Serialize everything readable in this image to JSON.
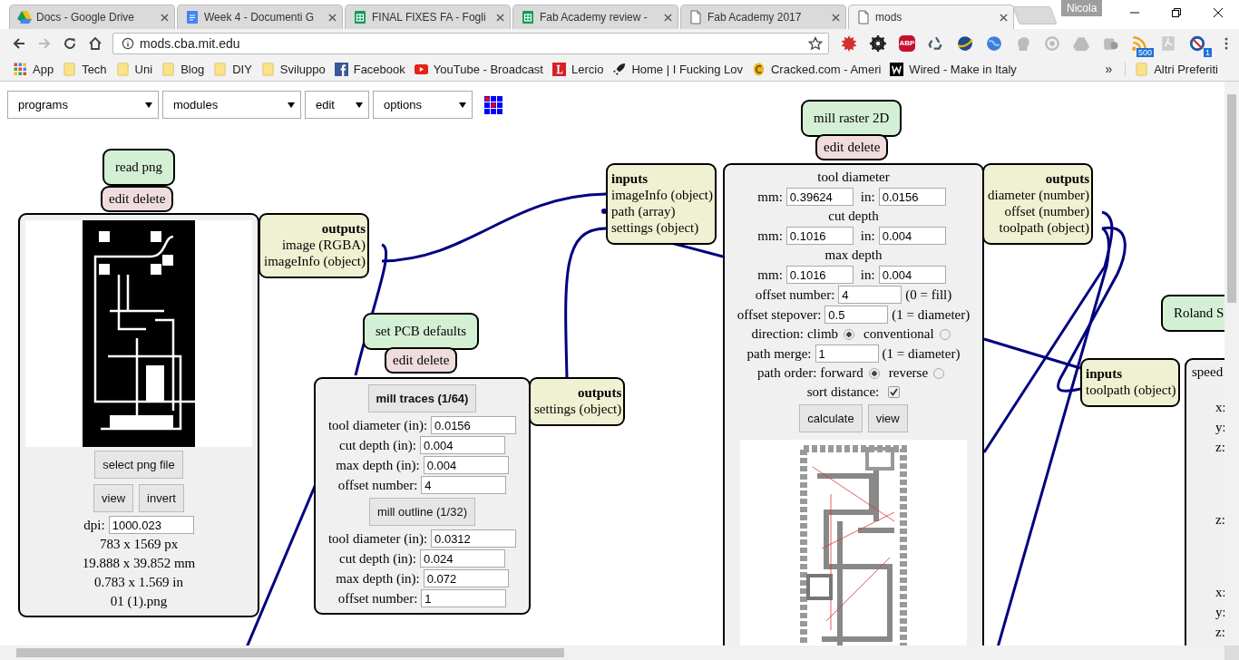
{
  "tabs": [
    {
      "title": "Docs - Google Drive",
      "kind": "drive",
      "selected": false
    },
    {
      "title": "Week 4 - Documenti G",
      "kind": "docs",
      "selected": false
    },
    {
      "title": "FINAL FIXES FA - Fogli",
      "kind": "sheets",
      "selected": false
    },
    {
      "title": "Fab Academy review -",
      "kind": "sheets",
      "selected": false
    },
    {
      "title": "Fab Academy 2017",
      "kind": "page",
      "selected": false
    },
    {
      "title": "mods",
      "kind": "page",
      "selected": true
    }
  ],
  "profile": "Nicola",
  "address": "mods.cba.mit.edu",
  "extensions": [
    {
      "kind": "burst"
    },
    {
      "kind": "gear"
    },
    {
      "kind": "octagon",
      "label": "ABP"
    },
    {
      "kind": "recycle"
    },
    {
      "kind": "planet"
    },
    {
      "kind": "globe"
    },
    {
      "kind": "head"
    },
    {
      "kind": "ring"
    },
    {
      "kind": "drive"
    },
    {
      "kind": "puzzle"
    },
    {
      "kind": "rss",
      "badge": "500"
    },
    {
      "kind": "pdf"
    },
    {
      "kind": "nosign",
      "badge": "1"
    }
  ],
  "bookmarks": [
    {
      "label": "App",
      "kind": "apps"
    },
    {
      "label": "Tech",
      "kind": "folder"
    },
    {
      "label": "Uni",
      "kind": "folder"
    },
    {
      "label": "Blog",
      "kind": "folder"
    },
    {
      "label": "DIY",
      "kind": "folder"
    },
    {
      "label": "Sviluppo",
      "kind": "folder"
    },
    {
      "label": "Facebook",
      "kind": "facebook"
    },
    {
      "label": "YouTube - Broadcast",
      "kind": "youtube"
    },
    {
      "label": "Lercio",
      "kind": "lercio"
    },
    {
      "label": "Home | I Fucking Lov",
      "kind": "rocket"
    },
    {
      "label": "Cracked.com - Ameri",
      "kind": "coin"
    },
    {
      "label": "Wired - Make in Italy",
      "kind": "wired"
    }
  ],
  "bookmarks_more": "»",
  "other_bookmarks": "Altri Preferiti",
  "menus": [
    "programs",
    "modules",
    "edit",
    "options"
  ],
  "modules": [
    {
      "title": "read png",
      "actions": [
        "edit",
        "delete"
      ],
      "outputs": {
        "heading": "outputs",
        "ports": [
          "image (RGBA)",
          "imageInfo (object)"
        ]
      },
      "body": [
        {
          "kind": "picture"
        },
        {
          "kind": "buttons",
          "buttons": [
            {
              "label": "select png file"
            }
          ]
        },
        {
          "kind": "buttons",
          "buttons": [
            {
              "label": "view"
            },
            {
              "label": "invert"
            }
          ]
        },
        {
          "kind": "field",
          "label": "dpi:",
          "value": "1000.023"
        },
        {
          "kind": "text",
          "text": "783 x 1569 px"
        },
        {
          "kind": "text",
          "text": "19.888 x 39.852 mm"
        },
        {
          "kind": "text",
          "text": "0.783 x 1.569 in"
        },
        {
          "kind": "text",
          "text": "01 (1).png"
        }
      ]
    },
    {
      "title": "set PCB defaults",
      "actions": [
        "edit",
        "delete"
      ],
      "outputs": {
        "heading": "outputs",
        "ports": [
          "settings (object)"
        ]
      },
      "body": [
        {
          "kind": "buttons",
          "buttons": [
            {
              "label": "mill traces (1/64)",
              "selected": true
            }
          ]
        },
        {
          "kind": "field",
          "label": "tool diameter (in):",
          "value": "0.0156"
        },
        {
          "kind": "field",
          "label": "cut depth (in):",
          "value": "0.004"
        },
        {
          "kind": "field",
          "label": "max depth (in):",
          "value": "0.004"
        },
        {
          "kind": "field",
          "label": "offset number:",
          "value": "4"
        },
        {
          "kind": "buttons",
          "buttons": [
            {
              "label": "mill outline (1/32)",
              "selected": false
            }
          ]
        },
        {
          "kind": "field",
          "label": "tool diameter (in):",
          "value": "0.0312"
        },
        {
          "kind": "field",
          "label": "cut depth (in):",
          "value": "0.024"
        },
        {
          "kind": "field",
          "label": "max depth (in):",
          "value": "0.072"
        },
        {
          "kind": "field",
          "label": "offset number:",
          "value": "1"
        }
      ]
    },
    {
      "title": "mill raster 2D",
      "actions": [
        "edit",
        "delete"
      ],
      "inputs": {
        "heading": "inputs",
        "ports": [
          "imageInfo (object)",
          "path (array)",
          "settings (object)"
        ]
      },
      "outputs": {
        "heading": "outputs",
        "ports": [
          "diameter (number)",
          "offset (number)",
          "toolpath (object)"
        ]
      },
      "body": [
        {
          "kind": "heading",
          "text": "tool diameter"
        },
        {
          "kind": "pair",
          "fields": [
            {
              "label": "mm:",
              "value": "0.39624"
            },
            {
              "label": "in:",
              "value": "0.0156"
            }
          ]
        },
        {
          "kind": "heading",
          "text": "cut depth"
        },
        {
          "kind": "pair",
          "fields": [
            {
              "label": "mm:",
              "value": "0.1016"
            },
            {
              "label": "in:",
              "value": "0.004"
            }
          ]
        },
        {
          "kind": "heading",
          "text": "max depth"
        },
        {
          "kind": "pair",
          "fields": [
            {
              "label": "mm:",
              "value": "0.1016"
            },
            {
              "label": "in:",
              "value": "0.004"
            }
          ]
        },
        {
          "kind": "field",
          "label": "offset number:",
          "value": "4",
          "note": "(0 = fill)"
        },
        {
          "kind": "field",
          "label": "offset stepover:",
          "value": "0.5",
          "note": "(1 = diameter)"
        },
        {
          "kind": "radio",
          "label": "direction:",
          "options": [
            {
              "label": "climb",
              "selected": true
            },
            {
              "label": "conventional",
              "selected": false
            }
          ]
        },
        {
          "kind": "field",
          "label": "path merge:",
          "value": "1",
          "note": "(1 = diameter)"
        },
        {
          "kind": "radio",
          "label": "path order:",
          "options": [
            {
              "label": "forward",
              "selected": true
            },
            {
              "label": "reverse",
              "selected": false
            }
          ]
        },
        {
          "kind": "checkbox",
          "label": "sort distance:",
          "checked": true
        },
        {
          "kind": "buttons",
          "buttons": [
            {
              "label": "calculate"
            },
            {
              "label": "view"
            }
          ]
        },
        {
          "kind": "picture"
        }
      ]
    },
    {
      "title": "Roland S",
      "inputs": {
        "heading": "inputs",
        "ports": [
          "toolpath (object)"
        ]
      },
      "body": [
        {
          "kind": "text",
          "text": "speed"
        },
        {
          "kind": "axes",
          "labels": [
            "x:",
            "y:",
            "z:"
          ]
        },
        {
          "kind": "axes",
          "labels": [
            "z:"
          ]
        },
        {
          "kind": "axes",
          "labels": [
            "x:",
            "y:",
            "z:"
          ]
        }
      ]
    }
  ]
}
